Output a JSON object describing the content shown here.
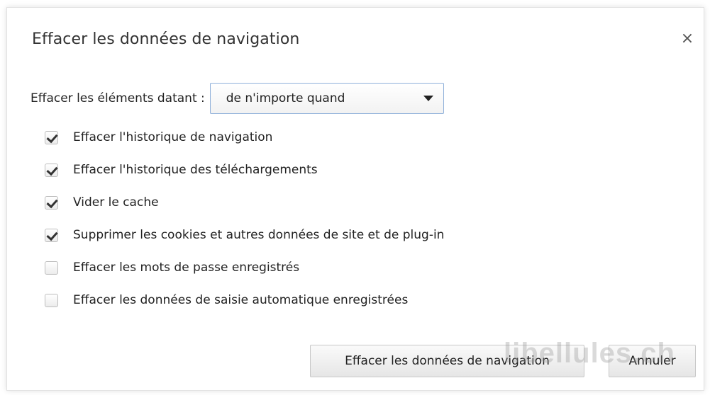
{
  "dialog": {
    "title": "Effacer les données de navigation",
    "close_icon": "close-icon",
    "close_glyph": "×"
  },
  "period": {
    "label": "Effacer les éléments datant :",
    "selected": "de n'importe quand",
    "arrow_icon": "chevron-down-icon"
  },
  "options": [
    {
      "label": "Effacer l'historique de navigation",
      "checked": true
    },
    {
      "label": "Effacer l'historique des téléchargements",
      "checked": true
    },
    {
      "label": "Vider le cache",
      "checked": true
    },
    {
      "label": "Supprimer les cookies et autres données de site et de plug-in",
      "checked": true
    },
    {
      "label": "Effacer les mots de passe enregistrés",
      "checked": false
    },
    {
      "label": "Effacer les données de saisie automatique enregistrées",
      "checked": false
    }
  ],
  "buttons": {
    "clear_label": "Effacer les données de navigation",
    "cancel_label": "Annuler"
  },
  "watermark": "libellules.ch"
}
